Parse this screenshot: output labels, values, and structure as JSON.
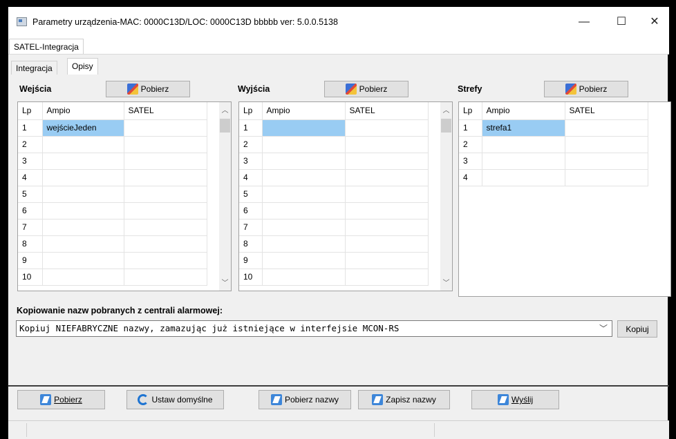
{
  "window": {
    "title": "Parametry urządzenia-MAC: 0000C13D/LOC: 0000C13D bbbbb ver: 5.0.0.5138",
    "minimize": "—",
    "maximize": "☐",
    "close": "✕"
  },
  "outer_tabs": [
    {
      "label": "SATEL-Integracja"
    }
  ],
  "inner_tabs": [
    {
      "label": "Integracja"
    },
    {
      "label": "Opisy"
    }
  ],
  "sections": {
    "wejscia": {
      "title": "Wejścia",
      "button": "Pobierz",
      "columns": [
        "Lp",
        "Ampio",
        "SATEL"
      ],
      "rows": [
        [
          "1",
          "wejścieJeden",
          ""
        ],
        [
          "2",
          "",
          ""
        ],
        [
          "3",
          "",
          ""
        ],
        [
          "4",
          "",
          ""
        ],
        [
          "5",
          "",
          ""
        ],
        [
          "6",
          "",
          ""
        ],
        [
          "7",
          "",
          ""
        ],
        [
          "8",
          "",
          ""
        ],
        [
          "9",
          "",
          ""
        ],
        [
          "10",
          "",
          ""
        ]
      ]
    },
    "wyjscia": {
      "title": "Wyjścia",
      "button": "Pobierz",
      "columns": [
        "Lp",
        "Ampio",
        "SATEL"
      ],
      "rows": [
        [
          "1",
          "",
          ""
        ],
        [
          "2",
          "",
          ""
        ],
        [
          "3",
          "",
          ""
        ],
        [
          "4",
          "",
          ""
        ],
        [
          "5",
          "",
          ""
        ],
        [
          "6",
          "",
          ""
        ],
        [
          "7",
          "",
          ""
        ],
        [
          "8",
          "",
          ""
        ],
        [
          "9",
          "",
          ""
        ],
        [
          "10",
          "",
          ""
        ]
      ]
    },
    "strefy": {
      "title": "Strefy",
      "button": "Pobierz",
      "columns": [
        "Lp",
        "Ampio",
        "SATEL"
      ],
      "rows": [
        [
          "1",
          "strefa1",
          ""
        ],
        [
          "2",
          "",
          ""
        ],
        [
          "3",
          "",
          ""
        ],
        [
          "4",
          "",
          ""
        ]
      ]
    }
  },
  "copy": {
    "label": "Kopiowanie nazw pobranych z centrali alarmowej:",
    "selected": "Kopiuj NIEFABRYCZNE nazwy, zamazując już istniejące w interfejsie MCON-RS",
    "button": "Kopiuj"
  },
  "bottom_buttons": {
    "pobierz": "Pobierz",
    "ustaw": "Ustaw domyślne",
    "pobierz_nazwy": "Pobierz nazwy",
    "zapisz_nazwy": "Zapisz nazwy",
    "wyslij": "Wyślij"
  },
  "colors": {
    "selection": "#99ccf3",
    "window_bg": "#f0f0f0"
  }
}
